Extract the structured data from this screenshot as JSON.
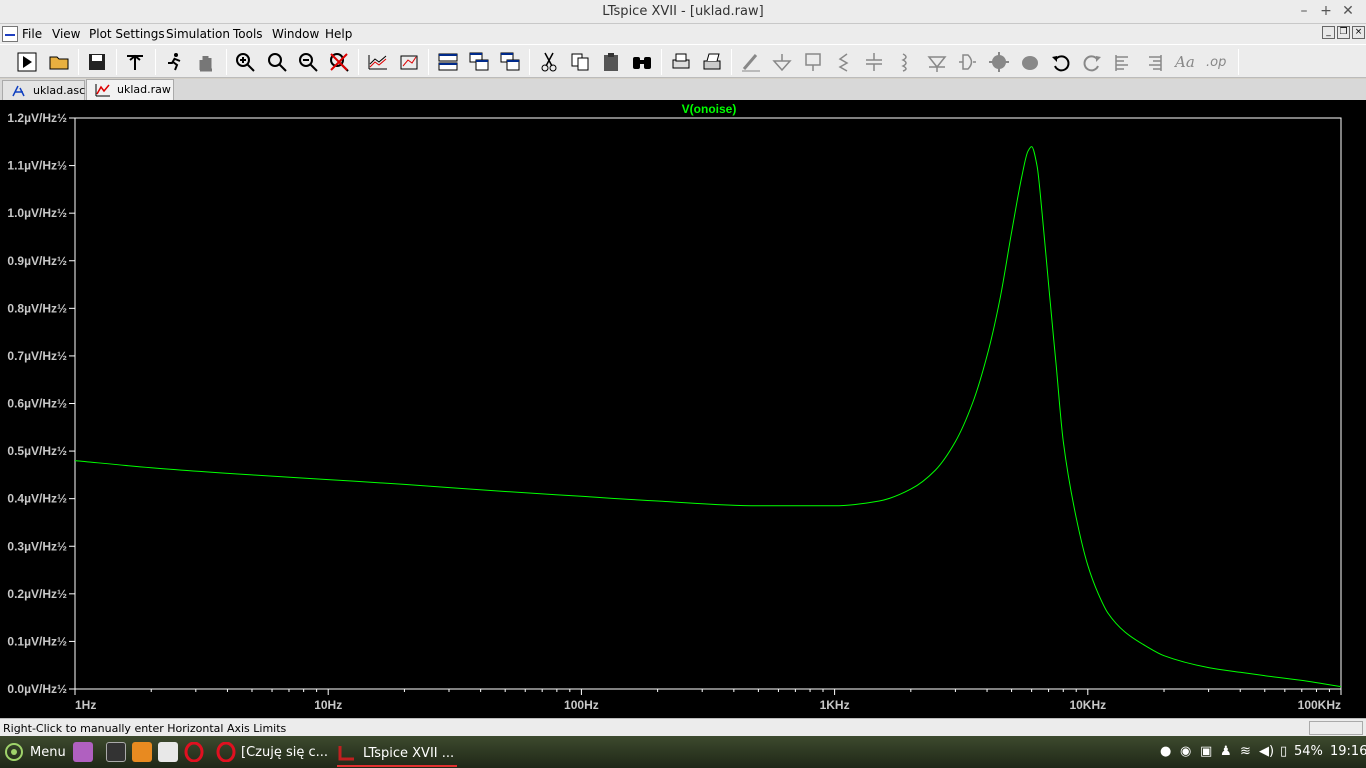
{
  "window": {
    "title": "LTspice XVII - [uklad.raw]"
  },
  "menu": {
    "items": [
      "File",
      "View",
      "Plot Settings",
      "Simulation",
      "Tools",
      "Window",
      "Help"
    ]
  },
  "toolbar": {
    "buttons": [
      "run-icon",
      "open-icon",
      "save-icon",
      "control-panel-icon",
      "halt-icon",
      "pan-icon",
      "zoom-in-icon",
      "zoom-area-icon",
      "zoom-out-icon",
      "zoom-fit-icon",
      "autorange-icon",
      "add-trace-icon",
      "tile-horizontal-icon",
      "cascade-icon",
      "tile-vertical-icon",
      "cut-icon",
      "copy-icon",
      "paste-icon",
      "find-icon",
      "print-preview-icon",
      "print-icon",
      "wire-icon",
      "ground-icon",
      "label-icon",
      "resistor-icon",
      "capacitor-icon",
      "inductor-icon",
      "diode-icon",
      "component-icon",
      "move-icon",
      "drag-icon",
      "undo-icon",
      "redo-icon",
      "rotate-icon",
      "mirror-icon",
      "text-icon",
      "spice-directive-icon"
    ]
  },
  "tabs": [
    {
      "label": "uklad.asc",
      "icon": "schematic-icon",
      "active": false
    },
    {
      "label": "uklad.raw",
      "icon": "waveform-icon",
      "active": true
    }
  ],
  "chart_data": {
    "type": "line",
    "title": "V(onoise)",
    "xscale": "log",
    "xlim": [
      1,
      100000
    ],
    "ylim": [
      0,
      1.2
    ],
    "yunit": "µV/Hz½",
    "xticks": [
      "1Hz",
      "10Hz",
      "100Hz",
      "1KHz",
      "10KHz",
      "100KHz"
    ],
    "yticks": [
      "0.0µV/Hz½",
      "0.1µV/Hz½",
      "0.2µV/Hz½",
      "0.3µV/Hz½",
      "0.4µV/Hz½",
      "0.5µV/Hz½",
      "0.6µV/Hz½",
      "0.7µV/Hz½",
      "0.8µV/Hz½",
      "0.9µV/Hz½",
      "1.0µV/Hz½",
      "1.1µV/Hz½",
      "1.2µV/Hz½"
    ],
    "colors": {
      "background": "#000000",
      "trace": "#00ff00",
      "axis": "#ffffff",
      "title": "#00ff00"
    },
    "series": [
      {
        "name": "V(onoise)",
        "x": [
          1,
          2,
          5,
          10,
          20,
          50,
          100,
          200,
          500,
          1000,
          1500,
          2000,
          2500,
          3000,
          3500,
          4000,
          4500,
          5000,
          5500,
          5800,
          6000,
          6300,
          6600,
          7000,
          7500,
          8000,
          9000,
          10000,
          11000,
          12000,
          14000,
          17000,
          20000,
          30000,
          40000,
          50000,
          70000,
          100000
        ],
        "y": [
          0.48,
          0.465,
          0.45,
          0.44,
          0.43,
          0.415,
          0.405,
          0.395,
          0.385,
          0.385,
          0.395,
          0.42,
          0.46,
          0.52,
          0.6,
          0.7,
          0.82,
          0.96,
          1.08,
          1.13,
          1.14,
          1.1,
          1.0,
          0.85,
          0.68,
          0.52,
          0.36,
          0.26,
          0.2,
          0.16,
          0.12,
          0.09,
          0.07,
          0.045,
          0.035,
          0.028,
          0.018,
          0.005
        ]
      }
    ],
    "grid": false
  },
  "status": {
    "message": "Right-Click to manually enter Horizontal Axis Limits"
  },
  "taskbar": {
    "menu_label": "Menu",
    "windows": [
      {
        "label": "[Czuję się c...",
        "icon": "opera-icon",
        "active": false
      },
      {
        "label": "LTspice XVII ...",
        "icon": "ltspice-icon",
        "active": true
      }
    ],
    "battery": "54%",
    "clock": "19:16"
  }
}
